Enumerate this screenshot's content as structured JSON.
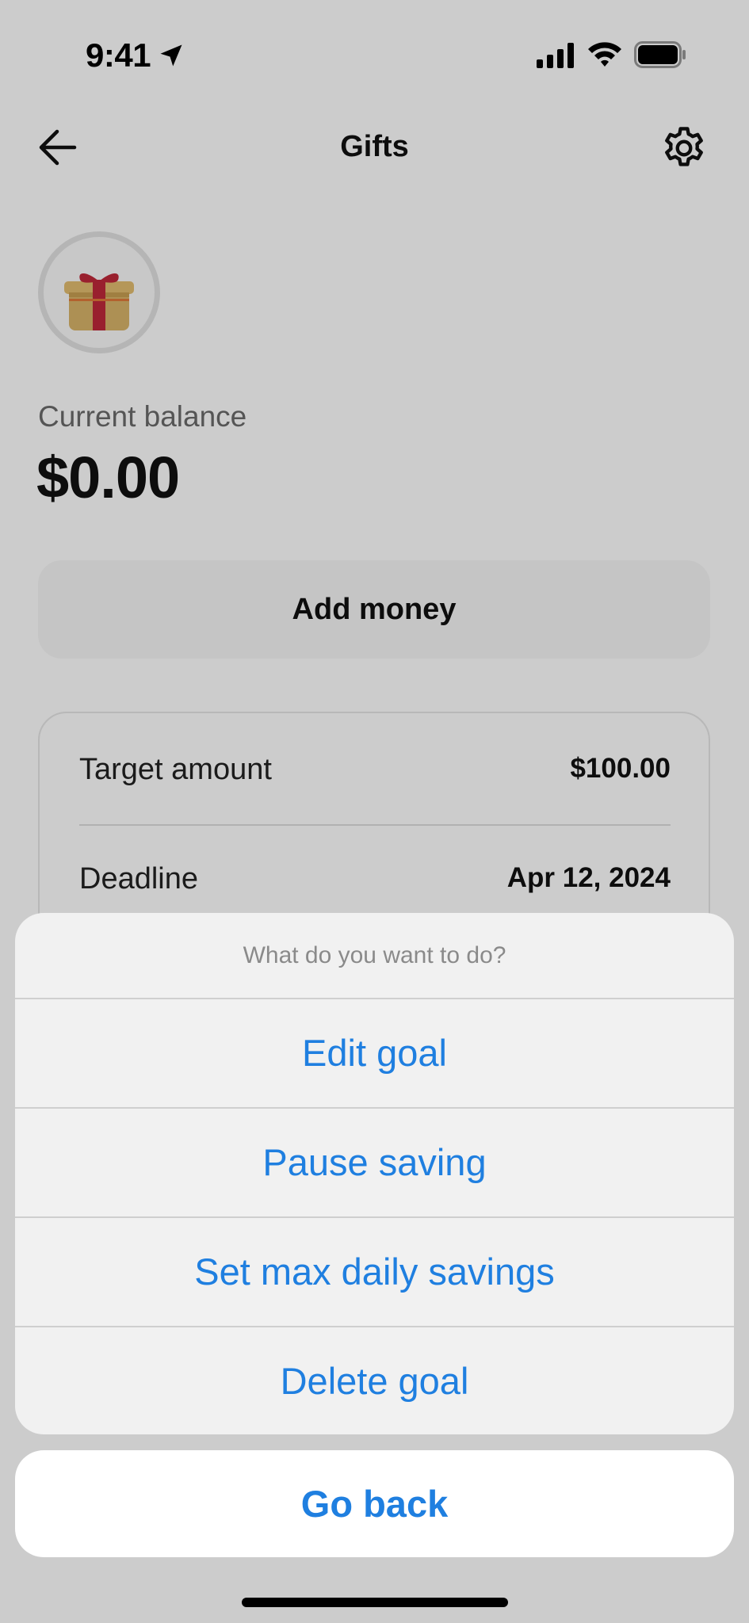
{
  "status_bar": {
    "time": "9:41"
  },
  "header": {
    "title": "Gifts"
  },
  "goal": {
    "icon": "gift-icon",
    "balance_label": "Current balance",
    "balance_value": "$0.00",
    "add_money_label": "Add money",
    "details": [
      {
        "label": "Target amount",
        "value": "$100.00"
      },
      {
        "label": "Deadline",
        "value": "Apr 12, 2024"
      }
    ]
  },
  "action_sheet": {
    "title": "What do you want to do?",
    "actions": [
      {
        "label": "Edit goal"
      },
      {
        "label": "Pause saving"
      },
      {
        "label": "Set max daily savings"
      },
      {
        "label": "Delete goal"
      }
    ],
    "cancel_label": "Go back"
  },
  "colors": {
    "action_blue": "#1f7fe0",
    "gift_box": "#d9b46a",
    "gift_ribbon": "#c0283a"
  }
}
